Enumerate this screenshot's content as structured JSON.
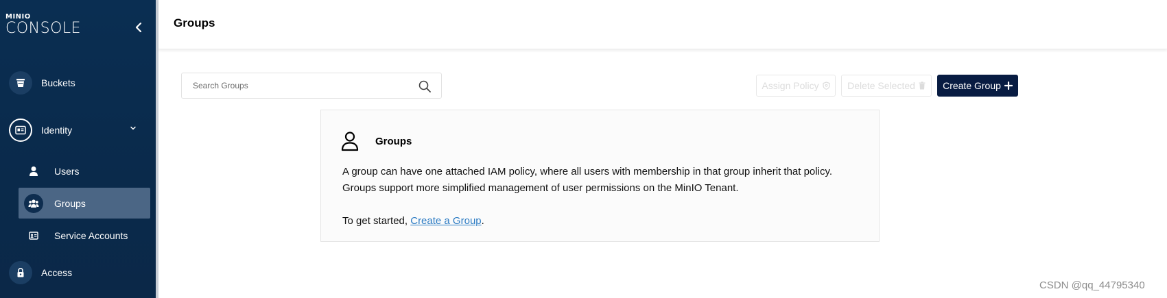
{
  "brand": {
    "top": "MINIO",
    "bottom": "CONSOLE"
  },
  "sidebar": {
    "items": [
      {
        "label": "Buckets",
        "icon": "bucket-icon"
      },
      {
        "label": "Identity",
        "icon": "identity-card-icon",
        "expanded": true,
        "children": [
          {
            "label": "Users",
            "icon": "user-icon"
          },
          {
            "label": "Groups",
            "icon": "groups-icon",
            "active": true
          },
          {
            "label": "Service Accounts",
            "icon": "service-account-icon"
          }
        ]
      },
      {
        "label": "Access",
        "icon": "lock-icon"
      }
    ]
  },
  "header": {
    "title": "Groups"
  },
  "toolbar": {
    "search_placeholder": "Search Groups",
    "assign_policy_label": "Assign Policy",
    "delete_selected_label": "Delete Selected",
    "create_group_label": "Create Group"
  },
  "info_card": {
    "title": "Groups",
    "line1": "A group can have one attached IAM policy, where all users with membership in that group inherit that policy.",
    "line2": "Groups support more simplified management of user permissions on the MinIO Tenant.",
    "cta_prefix": "To get started, ",
    "cta_link": "Create a Group",
    "cta_suffix": "."
  },
  "watermark": "CSDN @qq_44795340",
  "colors": {
    "sidebar_bg": "#0a2e52",
    "active_item_bg": "#4b6685",
    "primary_button": "#081c42",
    "link": "#2b7bc3"
  }
}
